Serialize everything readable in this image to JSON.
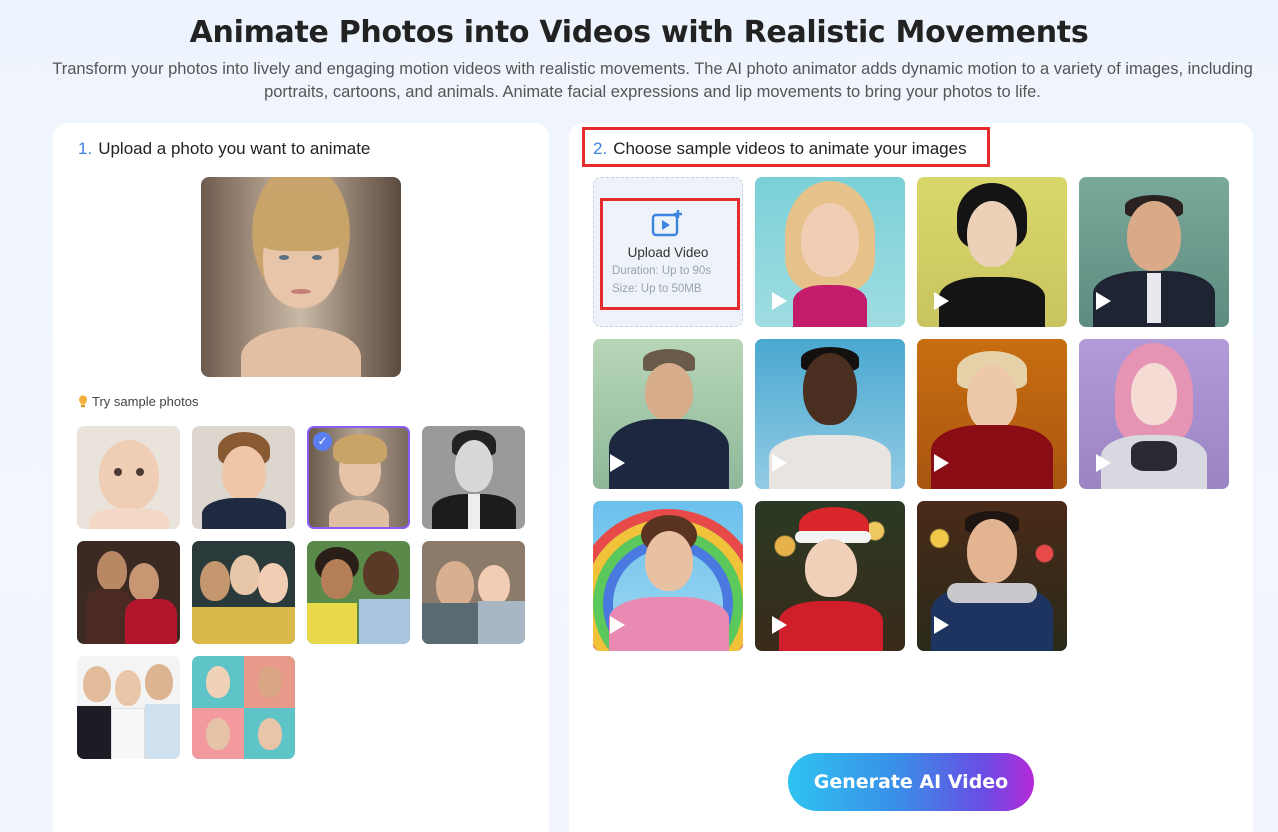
{
  "hero": {
    "title": "Animate Photos into Videos with Realistic Movements",
    "subtitle": "Transform your photos into lively and engaging motion videos with realistic movements. The AI photo animator adds dynamic motion to a variety of images, including portraits, cartoons, and animals. Animate facial expressions and lip movements to bring your photos to life."
  },
  "step1": {
    "number": "1.",
    "label": "Upload a photo you want to animate"
  },
  "step2": {
    "number": "2.",
    "label": "Choose sample videos to animate your images"
  },
  "try_samples": {
    "label": "Try sample photos",
    "icon": "lightbulb-icon"
  },
  "upload_video": {
    "title": "Upload Video",
    "duration": "Duration: Up to 90s",
    "size": "Size: Up to 50MB",
    "icon": "video-upload-icon"
  },
  "sample_photos_selected_index": 2,
  "generate_button": {
    "label": "Generate AI Video"
  },
  "colors": {
    "accent": "#3d84e0",
    "selected_border": "#8a5cf5",
    "highlight_red": "#e52b2b"
  }
}
